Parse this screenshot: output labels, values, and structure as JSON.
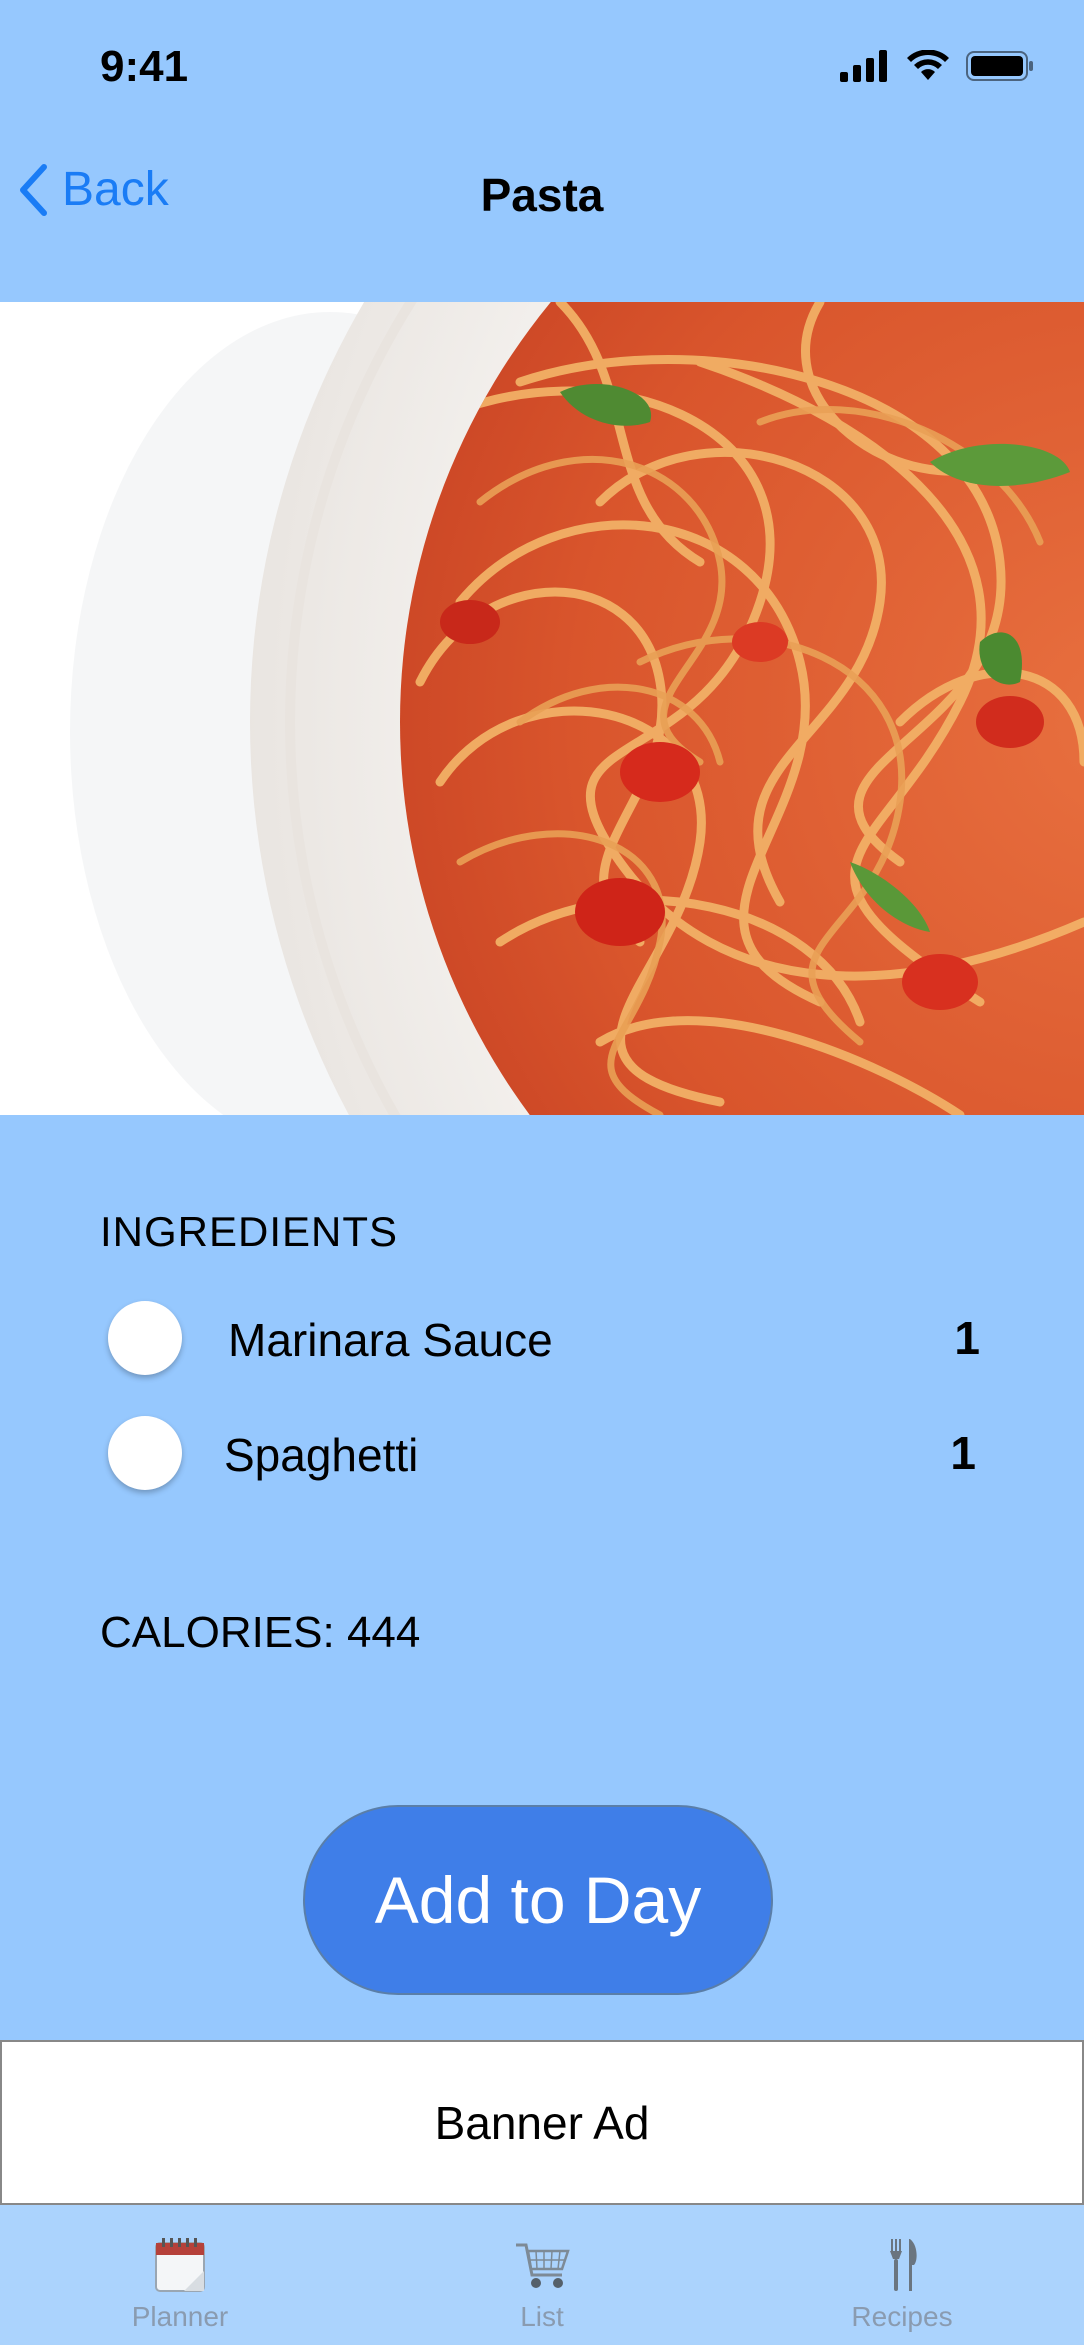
{
  "status": {
    "time": "9:41"
  },
  "nav": {
    "back_label": "Back",
    "title": "Pasta"
  },
  "ingredients": {
    "title": "INGREDIENTS",
    "items": [
      {
        "name": "Marinara Sauce",
        "qty": "1"
      },
      {
        "name": "Spaghetti",
        "qty": "1"
      }
    ]
  },
  "calories": "CALORIES: 444",
  "add_button": "Add to Day",
  "banner": "Banner Ad",
  "tabs": [
    {
      "label": "Planner",
      "icon": "calendar-icon"
    },
    {
      "label": "List",
      "icon": "cart-icon"
    },
    {
      "label": "Recipes",
      "icon": "fork-knife-icon"
    }
  ],
  "colors": {
    "background": "#96c8fe",
    "accent": "#1a7cf5",
    "button": "#3f7ee8",
    "tab_bar": "#abd3fd"
  }
}
